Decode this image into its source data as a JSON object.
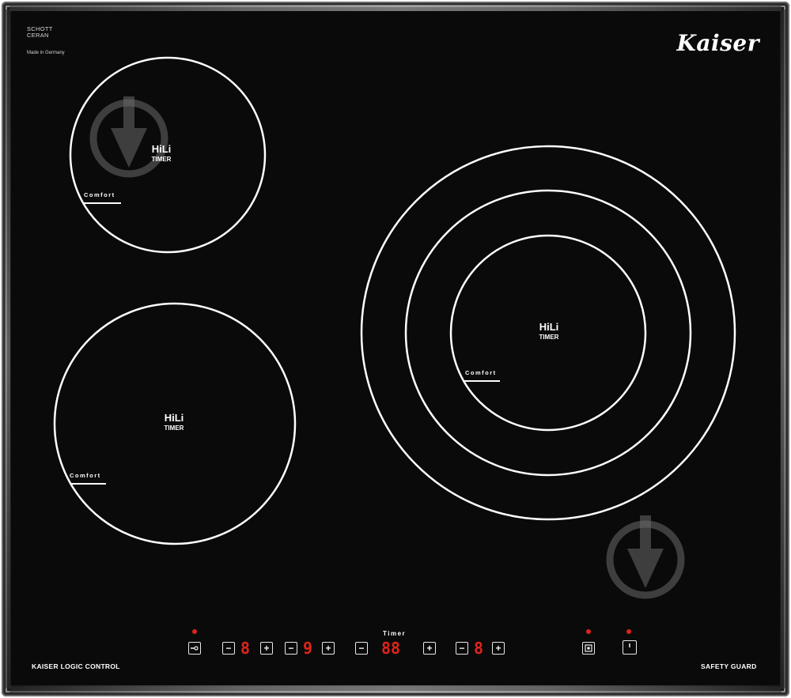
{
  "brand": "Kaiser",
  "manufacturer": {
    "line1": "SCHOTT",
    "line2": "CERAN",
    "made_in": "Made in Germany"
  },
  "zones": [
    {
      "name": "top-left",
      "label": "HiLi",
      "sub": "TIMER",
      "comfort": "Comfort"
    },
    {
      "name": "bottom-left",
      "label": "HiLi",
      "sub": "TIMER",
      "comfort": "Comfort"
    },
    {
      "name": "right-triple",
      "label": "HiLi",
      "sub": "TIMER",
      "comfort": "Comfort"
    }
  ],
  "controls": {
    "left_caption": "KAISER LOGIC CONTROL",
    "right_caption": "SAFETY GUARD",
    "timer_caption": "Timer",
    "minus_glyph": "−",
    "plus_glyph": "+",
    "zone1_digit": "8",
    "zone2_digit": "9",
    "timer_digits": "88",
    "zone3_digit": "8"
  },
  "colors": {
    "glass": "#0a0a0a",
    "display_red": "#e0241b",
    "print_white": "#ffffff"
  },
  "icons": [
    "zone-select-icon",
    "lock-icon",
    "power-icon",
    "watermark-arrow-icon"
  ]
}
